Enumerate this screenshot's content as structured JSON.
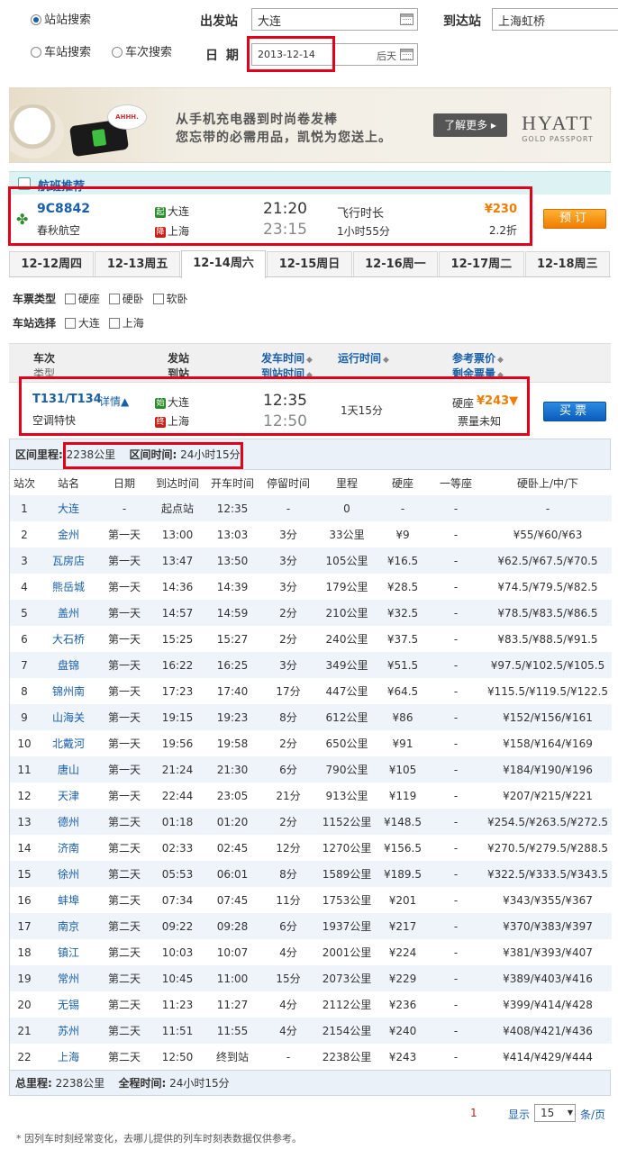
{
  "search": {
    "mode_station": "站站搜索",
    "mode_depart": "车站搜索",
    "mode_train": "车次搜索",
    "from_label": "出发站",
    "from_value": "大连",
    "to_label": "到达站",
    "to_value": "上海虹桥",
    "date_label": "日 期",
    "date_value": "2013-12-14",
    "date_hint": "后天"
  },
  "ad": {
    "text1": "从手机充电器到时尚卷发棒",
    "text2": "您忘带的必需用品，凯悦为您送上。",
    "phone_text": "AHHH.",
    "more": "了解更多 ▸",
    "brand": "HYATT",
    "brand_sub": "GOLD PASSPORT"
  },
  "flight": {
    "header": "航班推荐",
    "number": "9C8842",
    "airline": "春秋航空",
    "from_badge": "起",
    "from": "大连",
    "to_badge": "降",
    "to": "上海",
    "dep": "21:20",
    "arr": "23:15",
    "dur_label": "飞行时长",
    "dur": "1小时55分",
    "price": "¥230",
    "discount": "2.2折",
    "book": "预订"
  },
  "tabs": [
    "12-12周四",
    "12-13周五",
    "12-14周六",
    "12-15周日",
    "12-16周一",
    "12-17周二",
    "12-18周三"
  ],
  "filters": {
    "type_label": "车票类型",
    "types": [
      "硬座",
      "硬卧",
      "软卧"
    ],
    "station_label": "车站选择",
    "stations": [
      "大连",
      "上海"
    ]
  },
  "list_head": {
    "train": "车次",
    "type": "类型",
    "from": "发站",
    "to": "到站",
    "dep": "发车时间",
    "arr": "到站时间",
    "run": "运行时间",
    "price": "参考票价",
    "remain": "剩余票量"
  },
  "train": {
    "number": "T131/T134",
    "detail": "详情▲",
    "type": "空调特快",
    "from_badge": "始",
    "from": "大连",
    "to_badge": "终",
    "to": "上海",
    "dep": "12:35",
    "arr": "12:50",
    "run": "1天15分",
    "seat": "硬座",
    "price": "¥243▼",
    "remain": "票量未知",
    "buy": "买票"
  },
  "stops": {
    "dist_label": "区间里程:",
    "dist": "2238公里",
    "time_label": "区间时间:",
    "time": "24小时15分",
    "columns": [
      "站次",
      "站名",
      "日期",
      "到达时间",
      "开车时间",
      "停留时间",
      "里程",
      "硬座",
      "一等座",
      "硬卧上/中/下"
    ],
    "rows": [
      [
        "1",
        "大连",
        "-",
        "起点站",
        "12:35",
        "-",
        "0",
        "-",
        "-",
        "-"
      ],
      [
        "2",
        "金州",
        "第一天",
        "13:00",
        "13:03",
        "3分",
        "33公里",
        "¥9",
        "-",
        "¥55/¥60/¥63"
      ],
      [
        "3",
        "瓦房店",
        "第一天",
        "13:47",
        "13:50",
        "3分",
        "105公里",
        "¥16.5",
        "-",
        "¥62.5/¥67.5/¥70.5"
      ],
      [
        "4",
        "熊岳城",
        "第一天",
        "14:36",
        "14:39",
        "3分",
        "179公里",
        "¥28.5",
        "-",
        "¥74.5/¥79.5/¥82.5"
      ],
      [
        "5",
        "盖州",
        "第一天",
        "14:57",
        "14:59",
        "2分",
        "210公里",
        "¥32.5",
        "-",
        "¥78.5/¥83.5/¥86.5"
      ],
      [
        "6",
        "大石桥",
        "第一天",
        "15:25",
        "15:27",
        "2分",
        "240公里",
        "¥37.5",
        "-",
        "¥83.5/¥88.5/¥91.5"
      ],
      [
        "7",
        "盘锦",
        "第一天",
        "16:22",
        "16:25",
        "3分",
        "349公里",
        "¥51.5",
        "-",
        "¥97.5/¥102.5/¥105.5"
      ],
      [
        "8",
        "锦州南",
        "第一天",
        "17:23",
        "17:40",
        "17分",
        "447公里",
        "¥64.5",
        "-",
        "¥115.5/¥119.5/¥122.5"
      ],
      [
        "9",
        "山海关",
        "第一天",
        "19:15",
        "19:23",
        "8分",
        "612公里",
        "¥86",
        "-",
        "¥152/¥156/¥161"
      ],
      [
        "10",
        "北戴河",
        "第一天",
        "19:56",
        "19:58",
        "2分",
        "650公里",
        "¥91",
        "-",
        "¥158/¥164/¥169"
      ],
      [
        "11",
        "唐山",
        "第一天",
        "21:24",
        "21:30",
        "6分",
        "790公里",
        "¥105",
        "-",
        "¥184/¥190/¥196"
      ],
      [
        "12",
        "天津",
        "第一天",
        "22:44",
        "23:05",
        "21分",
        "913公里",
        "¥119",
        "-",
        "¥207/¥215/¥221"
      ],
      [
        "13",
        "德州",
        "第二天",
        "01:18",
        "01:20",
        "2分",
        "1152公里",
        "¥148.5",
        "-",
        "¥254.5/¥263.5/¥272.5"
      ],
      [
        "14",
        "济南",
        "第二天",
        "02:33",
        "02:45",
        "12分",
        "1270公里",
        "¥156.5",
        "-",
        "¥270.5/¥279.5/¥288.5"
      ],
      [
        "15",
        "徐州",
        "第二天",
        "05:53",
        "06:01",
        "8分",
        "1589公里",
        "¥189.5",
        "-",
        "¥322.5/¥333.5/¥343.5"
      ],
      [
        "16",
        "蚌埠",
        "第二天",
        "07:34",
        "07:45",
        "11分",
        "1753公里",
        "¥201",
        "-",
        "¥343/¥355/¥367"
      ],
      [
        "17",
        "南京",
        "第二天",
        "09:22",
        "09:28",
        "6分",
        "1937公里",
        "¥217",
        "-",
        "¥370/¥383/¥397"
      ],
      [
        "18",
        "镇江",
        "第二天",
        "10:03",
        "10:07",
        "4分",
        "2001公里",
        "¥224",
        "-",
        "¥381/¥393/¥407"
      ],
      [
        "19",
        "常州",
        "第二天",
        "10:45",
        "11:00",
        "15分",
        "2073公里",
        "¥229",
        "-",
        "¥389/¥403/¥416"
      ],
      [
        "20",
        "无锡",
        "第二天",
        "11:23",
        "11:27",
        "4分",
        "2112公里",
        "¥236",
        "-",
        "¥399/¥414/¥428"
      ],
      [
        "21",
        "苏州",
        "第二天",
        "11:51",
        "11:55",
        "4分",
        "2154公里",
        "¥240",
        "-",
        "¥408/¥421/¥436"
      ],
      [
        "22",
        "上海",
        "第二天",
        "12:50",
        "终到站",
        "-",
        "2238公里",
        "¥243",
        "-",
        "¥414/¥429/¥444"
      ]
    ],
    "total_dist_label": "总里程:",
    "total_dist": "2238公里",
    "total_time_label": "全程时间:",
    "total_time": "24小时15分"
  },
  "pager": {
    "page": "1",
    "show": "显示",
    "size": "15",
    "unit": "条/页"
  },
  "note": "* 因列车时刻经常变化，去哪儿提供的列车时刻表数据仅供参考。"
}
